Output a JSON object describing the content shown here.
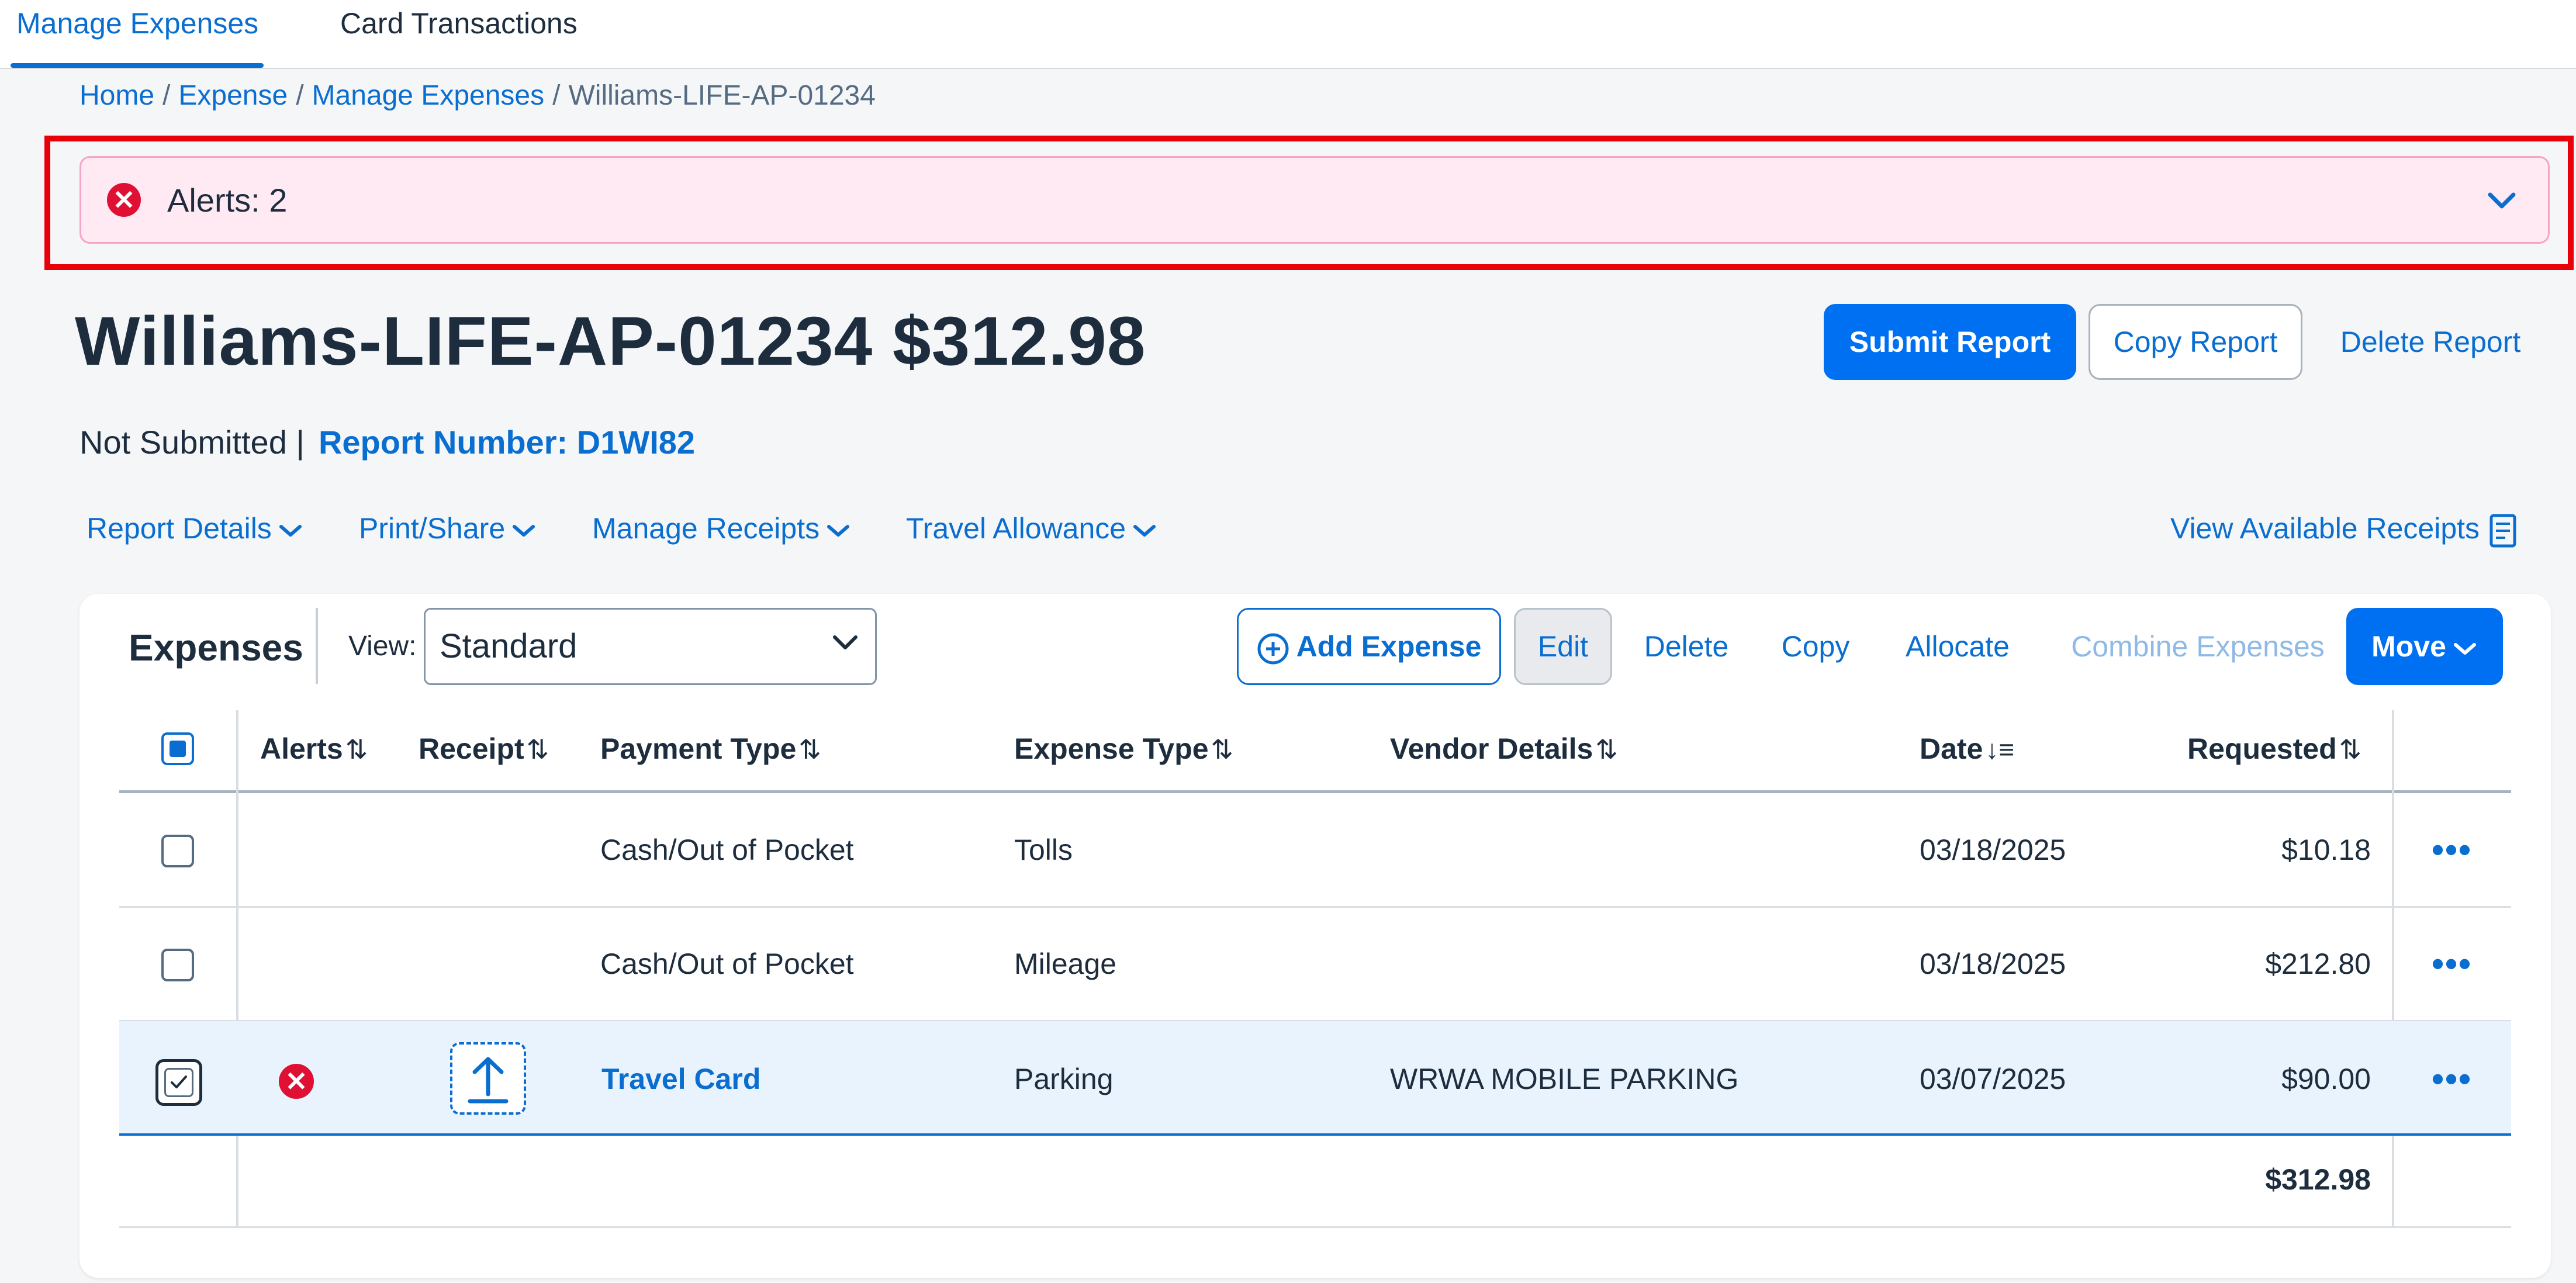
{
  "tabs": [
    {
      "label": "Manage Expenses",
      "active": true
    },
    {
      "label": "Card Transactions",
      "active": false
    }
  ],
  "breadcrumb": {
    "items": [
      "Home",
      "Expense",
      "Manage Expenses"
    ],
    "current": "Williams-LIFE-AP-01234",
    "separator": "/"
  },
  "alerts": {
    "label": "Alerts: 2",
    "icon": "error-circle-icon",
    "color": "#e00f34"
  },
  "report": {
    "title": "Williams-LIFE-AP-01234 $312.98",
    "status": "Not Submitted |",
    "report_number": "Report Number: D1WI82"
  },
  "actions": {
    "submit": "Submit Report",
    "copy": "Copy Report",
    "delete": "Delete Report"
  },
  "menu": {
    "report_details": "Report Details",
    "print_share": "Print/Share",
    "manage_receipts": "Manage Receipts",
    "travel_allowance": "Travel Allowance",
    "view_receipts": "View Available Receipts"
  },
  "expenses": {
    "title": "Expenses",
    "view_label": "View:",
    "view_value": "Standard",
    "buttons": {
      "add": "Add Expense",
      "edit": "Edit",
      "delete": "Delete",
      "copy": "Copy",
      "allocate": "Allocate",
      "combine": "Combine Expenses",
      "move": "Move"
    },
    "columns": {
      "alerts": "Alerts",
      "receipt": "Receipt",
      "payment_type": "Payment Type",
      "expense_type": "Expense Type",
      "vendor": "Vendor Details",
      "date": "Date",
      "requested": "Requested"
    },
    "rows": [
      {
        "payment_type": "Cash/Out of Pocket",
        "expense_type": "Tolls",
        "vendor": "",
        "date": "03/18/2025",
        "requested": "$10.18",
        "checked": false
      },
      {
        "payment_type": "Cash/Out of Pocket",
        "expense_type": "Mileage",
        "vendor": "",
        "date": "03/18/2025",
        "requested": "$212.80",
        "checked": false
      },
      {
        "payment_type": "Travel Card",
        "expense_type": "Parking",
        "vendor": "WRWA MOBILE PARKING",
        "date": "03/07/2025",
        "requested": "$90.00",
        "checked": true,
        "alert": true,
        "receipt_upload": true
      }
    ],
    "total": "$312.98"
  },
  "colors": {
    "accent": "#0070f2",
    "link": "#0a6ed1",
    "alert_bg": "#ffeaf4",
    "alert_outline": "#e8000b",
    "selected_row": "#e8f3fd"
  }
}
